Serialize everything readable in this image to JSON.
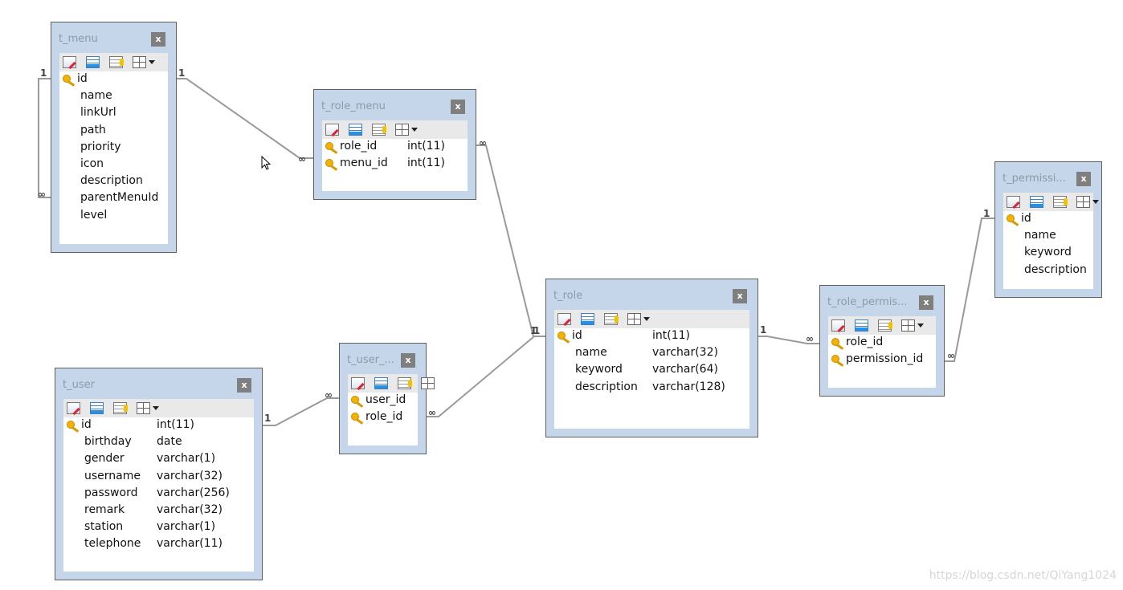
{
  "tables": [
    {
      "id": "t_menu",
      "title": "t_menu",
      "close": "x",
      "toolbar_dropdown": true,
      "fields": [
        {
          "name": "id",
          "pk": true,
          "type": ""
        },
        {
          "name": "name",
          "type": ""
        },
        {
          "name": "linkUrl",
          "type": ""
        },
        {
          "name": "path",
          "type": ""
        },
        {
          "name": "priority",
          "type": ""
        },
        {
          "name": "icon",
          "type": ""
        },
        {
          "name": "description",
          "type": ""
        },
        {
          "name": "parentMenuId",
          "type": ""
        },
        {
          "name": "level",
          "type": ""
        }
      ]
    },
    {
      "id": "t_role_menu",
      "title": "t_role_menu",
      "close": "x",
      "toolbar_dropdown": true,
      "fields": [
        {
          "name": "role_id",
          "pk": true,
          "type": "int(11)"
        },
        {
          "name": "menu_id",
          "pk": true,
          "type": "int(11)"
        }
      ]
    },
    {
      "id": "t_permission",
      "title": "t_permissi...",
      "close": "x",
      "toolbar_dropdown": true,
      "fields": [
        {
          "name": "id",
          "pk": true,
          "type": ""
        },
        {
          "name": "name",
          "type": ""
        },
        {
          "name": "keyword",
          "type": ""
        },
        {
          "name": "description",
          "type": ""
        }
      ]
    },
    {
      "id": "t_role",
      "title": "t_role",
      "close": "x",
      "toolbar_dropdown": true,
      "fields": [
        {
          "name": "id",
          "pk": true,
          "type": "int(11)"
        },
        {
          "name": "name",
          "type": "varchar(32)"
        },
        {
          "name": "keyword",
          "type": "varchar(64)"
        },
        {
          "name": "description",
          "type": "varchar(128)"
        }
      ]
    },
    {
      "id": "t_role_permission",
      "title": "t_role_permis...",
      "close": "x",
      "toolbar_dropdown": true,
      "fields": [
        {
          "name": "role_id",
          "pk": true,
          "type": ""
        },
        {
          "name": "permission_id",
          "pk": true,
          "type": ""
        }
      ]
    },
    {
      "id": "t_user_role",
      "title": "t_user_...",
      "close": "x",
      "toolbar_dropdown": false,
      "fields": [
        {
          "name": "user_id",
          "pk": true,
          "type": ""
        },
        {
          "name": "role_id",
          "pk": true,
          "type": ""
        }
      ]
    },
    {
      "id": "t_user",
      "title": "t_user",
      "close": "x",
      "toolbar_dropdown": true,
      "fields": [
        {
          "name": "id",
          "pk": true,
          "type": "int(11)"
        },
        {
          "name": "birthday",
          "type": "date"
        },
        {
          "name": "gender",
          "type": "varchar(1)"
        },
        {
          "name": "username",
          "type": "varchar(32)"
        },
        {
          "name": "password",
          "type": "varchar(256)"
        },
        {
          "name": "remark",
          "type": "varchar(32)"
        },
        {
          "name": "station",
          "type": "varchar(1)"
        },
        {
          "name": "telephone",
          "type": "varchar(11)"
        }
      ]
    }
  ],
  "relations": [
    {
      "id": "menu-self",
      "from_label": "1",
      "to_label": "∞"
    },
    {
      "id": "menu-rolemenu",
      "from_label": "1",
      "to_label": "∞"
    },
    {
      "id": "rolemenu-role",
      "from_label": "∞",
      "to_label": "1"
    },
    {
      "id": "role-rolepermission",
      "from_label": "1",
      "to_label": "∞"
    },
    {
      "id": "rolepermission-permission",
      "from_label": "∞",
      "to_label": "1"
    },
    {
      "id": "user-userrole",
      "from_label": "1",
      "to_label": "∞"
    },
    {
      "id": "userrole-role",
      "from_label": "∞",
      "to_label": "1"
    }
  ],
  "watermark": "https://blog.csdn.net/QiYang1024"
}
